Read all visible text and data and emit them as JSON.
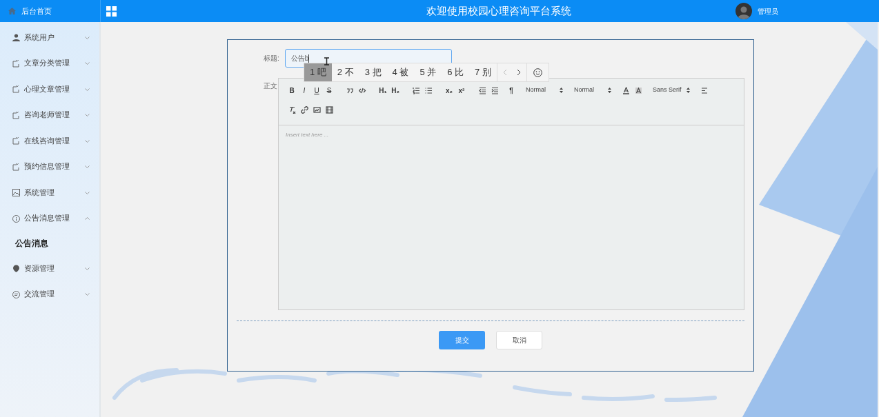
{
  "brand": {
    "title": "后台首页"
  },
  "header": {
    "title": "欢迎使用校园心理咨询平台系统",
    "user": "管理员"
  },
  "sidebar": {
    "items": [
      {
        "label": "系统用户",
        "kind": "person",
        "expanded": false
      },
      {
        "label": "文章分类管理",
        "kind": "doc",
        "expanded": false
      },
      {
        "label": "心理文章管理",
        "kind": "doc",
        "expanded": false
      },
      {
        "label": "咨询老师管理",
        "kind": "doc",
        "expanded": false
      },
      {
        "label": "在线咨询管理",
        "kind": "doc",
        "expanded": false
      },
      {
        "label": "预约信息管理",
        "kind": "doc",
        "expanded": false
      },
      {
        "label": "系统管理",
        "kind": "image",
        "expanded": false
      },
      {
        "label": "公告消息管理",
        "kind": "info",
        "expanded": true,
        "children": [
          {
            "label": "公告消息",
            "selected": true
          }
        ]
      },
      {
        "label": "资源管理",
        "kind": "pin",
        "expanded": false
      },
      {
        "label": "交流管理",
        "kind": "chat",
        "expanded": false
      }
    ]
  },
  "form": {
    "title_label": "标题:",
    "title_value": "公告b",
    "body_label": "正文",
    "placeholder": "Insert text here ...",
    "toolbar": [
      {
        "kind": "bold",
        "label": "B"
      },
      {
        "kind": "italic",
        "label": "I"
      },
      {
        "kind": "underline",
        "label": "U"
      },
      {
        "kind": "strike",
        "label": "S"
      },
      {
        "kind": "quote"
      },
      {
        "kind": "code"
      },
      {
        "kind": "bold",
        "label": "H₁"
      },
      {
        "kind": "bold",
        "label": "H₂"
      },
      {
        "kind": "ordered"
      },
      {
        "kind": "bullet"
      },
      {
        "kind": "bold",
        "label": "x₂"
      },
      {
        "kind": "bold",
        "label": "x²"
      },
      {
        "kind": "outdent"
      },
      {
        "kind": "indent"
      },
      {
        "kind": "bold",
        "label": "¶"
      },
      {
        "kind": "select",
        "label": "Normal"
      },
      {
        "kind": "select",
        "label": "Normal"
      },
      {
        "kind": "color"
      },
      {
        "kind": "background"
      },
      {
        "kind": "select",
        "label": "Sans Serif"
      },
      {
        "kind": "align"
      },
      {
        "kind": "break"
      },
      {
        "kind": "clean"
      },
      {
        "kind": "link"
      },
      {
        "kind": "image"
      },
      {
        "kind": "video"
      }
    ],
    "buttons": [
      {
        "label": "提交",
        "kind": "primary"
      },
      {
        "label": "取消",
        "kind": "plain"
      }
    ]
  },
  "ime": {
    "candidates": [
      {
        "label": "1 吧",
        "selected": true
      },
      {
        "label": "2 不",
        "selected": false
      },
      {
        "label": "3 把",
        "selected": false
      },
      {
        "label": "4 被",
        "selected": false
      },
      {
        "label": "5 并",
        "selected": false
      },
      {
        "label": "6 比",
        "selected": false
      },
      {
        "label": "7 别",
        "selected": false
      }
    ]
  }
}
